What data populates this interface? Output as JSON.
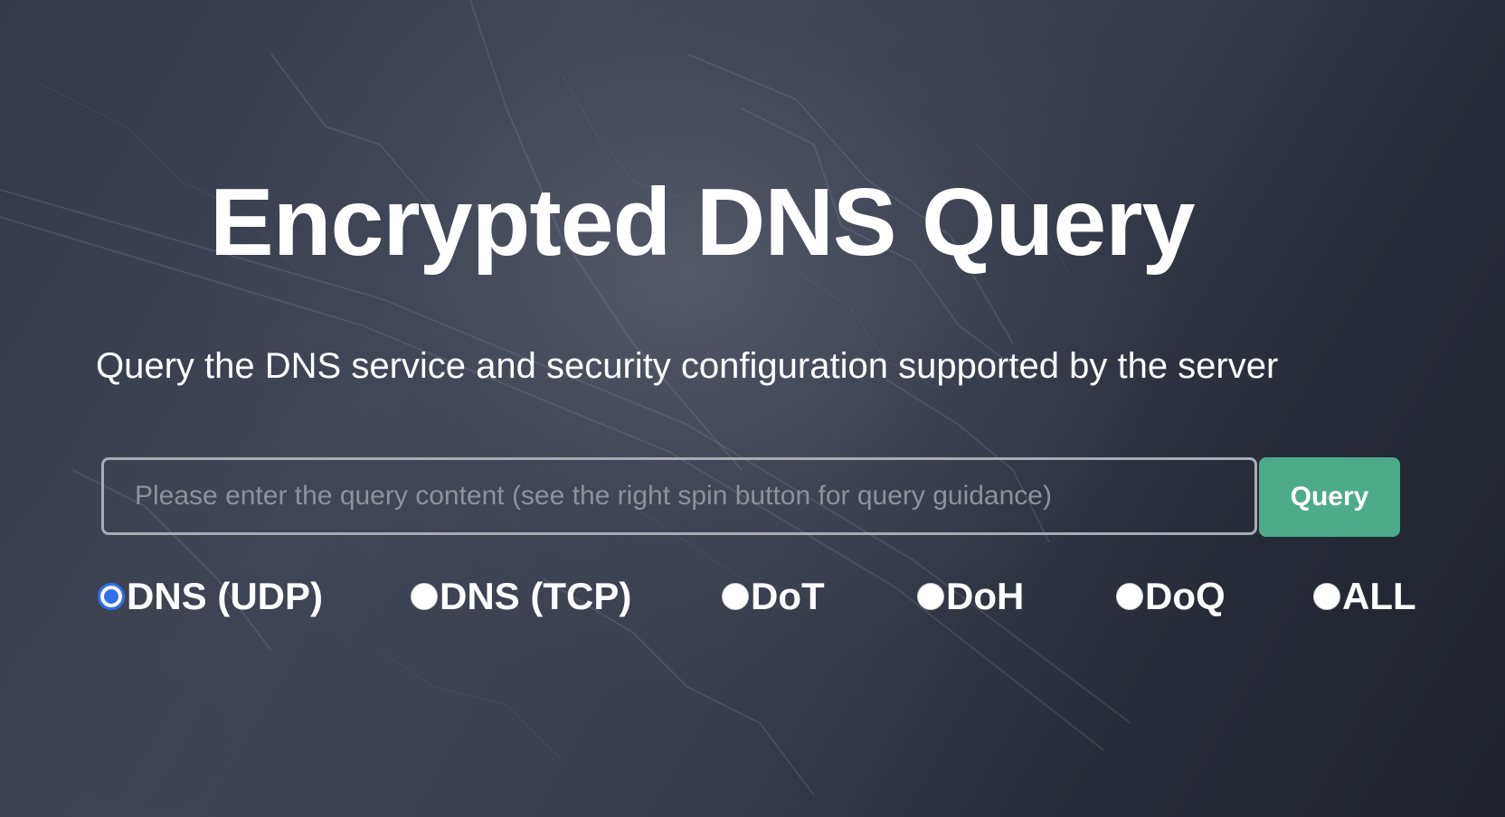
{
  "hero": {
    "title": "Encrypted DNS Query",
    "subtitle": "Query the DNS service and security configuration supported by the server"
  },
  "search": {
    "placeholder": "Please enter the query content (see the right spin button for query guidance)",
    "value": "",
    "button_label": "Query"
  },
  "protocols": {
    "selected": "DNS (UDP)",
    "options": [
      {
        "label": "DNS (UDP)",
        "checked": true
      },
      {
        "label": "DNS (TCP)",
        "checked": false
      },
      {
        "label": "DoT",
        "checked": false
      },
      {
        "label": "DoH",
        "checked": false
      },
      {
        "label": "DoQ",
        "checked": false
      },
      {
        "label": "ALL",
        "checked": false
      }
    ]
  },
  "colors": {
    "accent_button": "#4dab8a",
    "radio_selected": "#2f6fec",
    "text": "#ffffff",
    "placeholder": "#8e929b"
  }
}
